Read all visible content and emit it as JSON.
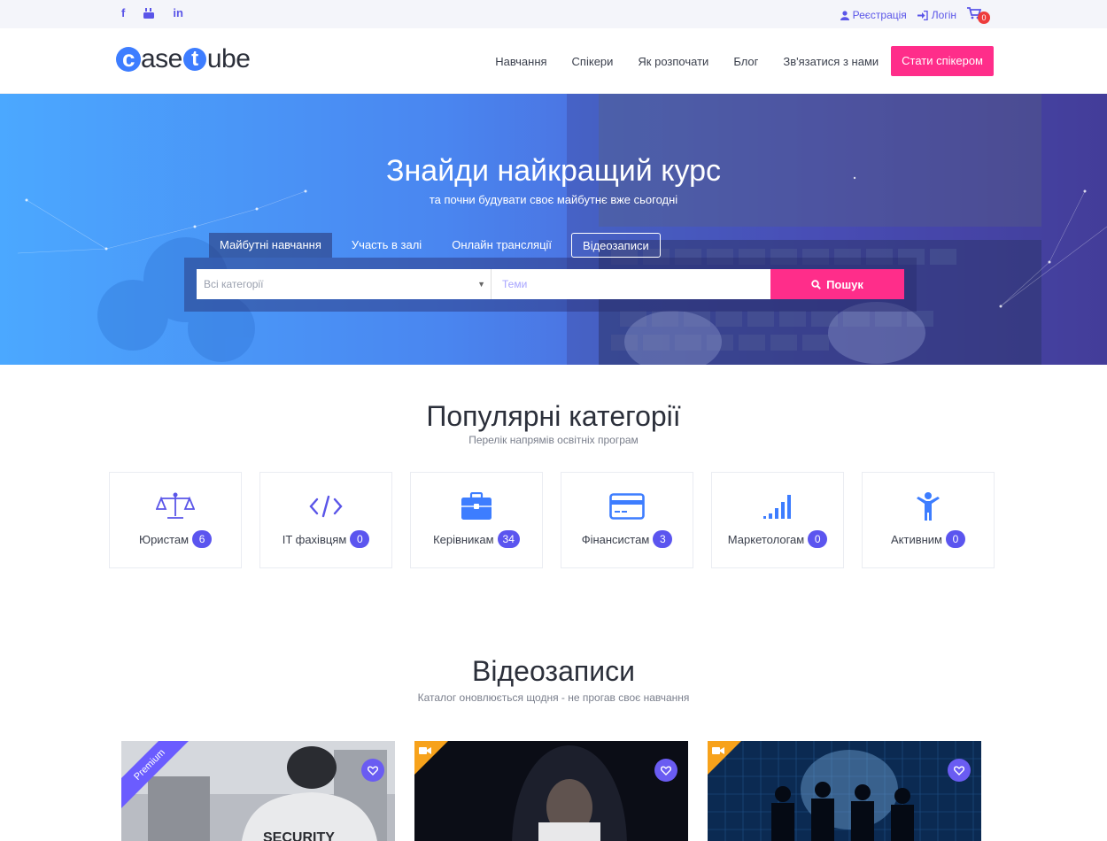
{
  "topbar": {
    "social": [
      {
        "icon": "facebook-icon",
        "glyph": "f"
      },
      {
        "icon": "youtube-icon",
        "glyph": "▶"
      },
      {
        "icon": "linkedin-icon",
        "glyph": "in"
      }
    ],
    "register_label": "Реєстрація",
    "login_label": "Логін",
    "cart_count": "0"
  },
  "header": {
    "logo_text": "casetube",
    "nav": [
      "Навчання",
      "Спікери",
      "Як розпочати",
      "Блог",
      "Зв'язатися з нами"
    ],
    "cta_label": "Стати спікером"
  },
  "hero": {
    "title": "Знайди найкращий курс",
    "subtitle": "та почни будувати своє майбутнє вже сьогодні",
    "tabs": [
      "Майбутні навчання",
      "Участь в залі",
      "Онлайн трансляції",
      "Відеозаписи"
    ],
    "category_select": "Всі категорії",
    "topic_placeholder": "Теми",
    "search_label": "Пошук"
  },
  "categories": {
    "title": "Популярні категорії",
    "subtitle": "Перелік напрямів освітніх програм",
    "items": [
      {
        "label": "Юристам",
        "count": "6",
        "icon": "scales-icon"
      },
      {
        "label": "IT фахівцям",
        "count": "0",
        "icon": "code-icon"
      },
      {
        "label": "Керівникам",
        "count": "34",
        "icon": "briefcase-icon"
      },
      {
        "label": "Фінансистам",
        "count": "3",
        "icon": "credit-card-icon"
      },
      {
        "label": "Маркетологам",
        "count": "0",
        "icon": "signal-bars-icon"
      },
      {
        "label": "Активним",
        "count": "0",
        "icon": "person-icon"
      }
    ]
  },
  "videos": {
    "title": "Відеозаписи",
    "subtitle": "Каталог оновлюється щодня - не прогав своє навчання",
    "cards": [
      {
        "ribbon": "Premium",
        "image": "security-guard-photo"
      },
      {
        "ribbon": "",
        "image": "hooded-person-photo"
      },
      {
        "ribbon": "",
        "image": "business-silhouettes-photo"
      }
    ]
  },
  "colors": {
    "accent": "#5a55e8",
    "cta": "#ff2d8a",
    "badge": "#5b55ef",
    "premium": "#6b5cff",
    "video_corner": "#f7a21b"
  }
}
